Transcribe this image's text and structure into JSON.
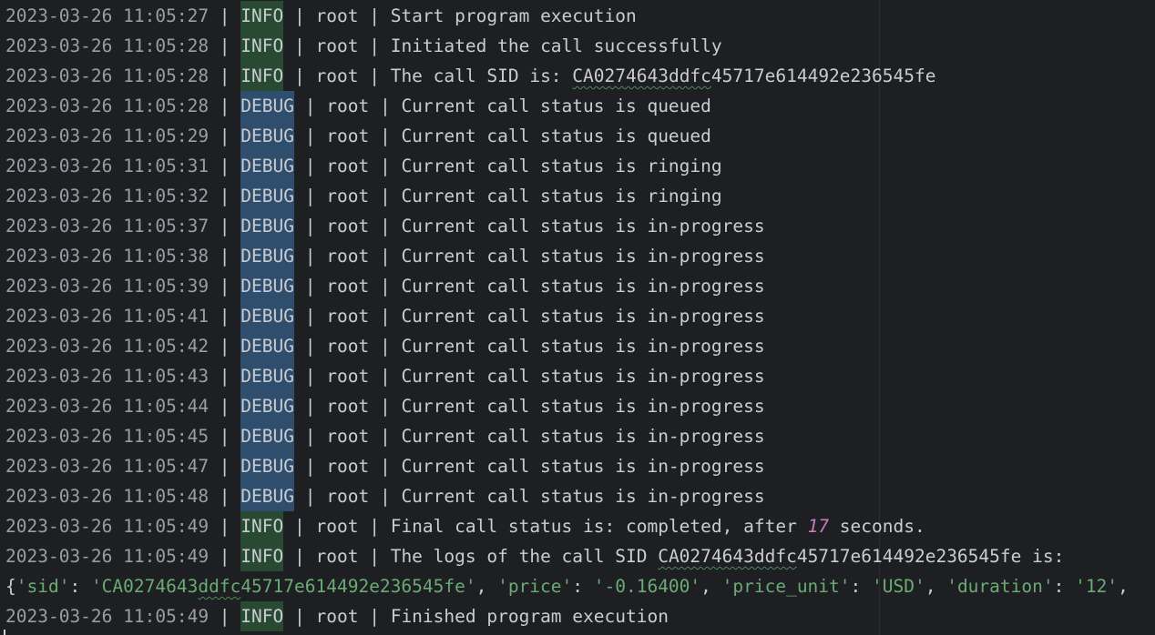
{
  "log_lines": [
    {
      "ts": "2023-03-26 11:05:27",
      "level": "INFO",
      "logger": "root",
      "msg": "Start program execution"
    },
    {
      "ts": "2023-03-26 11:05:28",
      "level": "INFO",
      "logger": "root",
      "msg": "Initiated the call successfully"
    },
    {
      "ts": "2023-03-26 11:05:28",
      "level": "INFO",
      "logger": "root",
      "msg_prefix": "The call SID is: ",
      "msg_mark": "CA0274643ddfc",
      "msg_suffix": "45717e614492e236545fe"
    },
    {
      "ts": "2023-03-26 11:05:28",
      "level": "DEBUG",
      "logger": "root",
      "msg": "Current call status is queued"
    },
    {
      "ts": "2023-03-26 11:05:29",
      "level": "DEBUG",
      "logger": "root",
      "msg": "Current call status is queued"
    },
    {
      "ts": "2023-03-26 11:05:31",
      "level": "DEBUG",
      "logger": "root",
      "msg": "Current call status is ringing"
    },
    {
      "ts": "2023-03-26 11:05:32",
      "level": "DEBUG",
      "logger": "root",
      "msg": "Current call status is ringing"
    },
    {
      "ts": "2023-03-26 11:05:37",
      "level": "DEBUG",
      "logger": "root",
      "msg": "Current call status is in-progress"
    },
    {
      "ts": "2023-03-26 11:05:38",
      "level": "DEBUG",
      "logger": "root",
      "msg": "Current call status is in-progress"
    },
    {
      "ts": "2023-03-26 11:05:39",
      "level": "DEBUG",
      "logger": "root",
      "msg": "Current call status is in-progress"
    },
    {
      "ts": "2023-03-26 11:05:41",
      "level": "DEBUG",
      "logger": "root",
      "msg": "Current call status is in-progress"
    },
    {
      "ts": "2023-03-26 11:05:42",
      "level": "DEBUG",
      "logger": "root",
      "msg": "Current call status is in-progress"
    },
    {
      "ts": "2023-03-26 11:05:43",
      "level": "DEBUG",
      "logger": "root",
      "msg": "Current call status is in-progress"
    },
    {
      "ts": "2023-03-26 11:05:44",
      "level": "DEBUG",
      "logger": "root",
      "msg": "Current call status is in-progress"
    },
    {
      "ts": "2023-03-26 11:05:45",
      "level": "DEBUG",
      "logger": "root",
      "msg": "Current call status is in-progress"
    },
    {
      "ts": "2023-03-26 11:05:47",
      "level": "DEBUG",
      "logger": "root",
      "msg": "Current call status is in-progress"
    },
    {
      "ts": "2023-03-26 11:05:48",
      "level": "DEBUG",
      "logger": "root",
      "msg": "Current call status is in-progress"
    },
    {
      "ts": "2023-03-26 11:05:49",
      "level": "INFO",
      "logger": "root",
      "msg_prefix": "Final call status is: completed, after ",
      "msg_num": "17",
      "msg_suffix": " seconds."
    },
    {
      "ts": "2023-03-26 11:05:49",
      "level": "INFO",
      "logger": "root",
      "msg_prefix": "The logs of the call SID ",
      "msg_mark": "CA0274643ddfc",
      "msg_suffix": "45717e614492e236545fe is:"
    },
    {
      "dict_line": true,
      "parts": [
        "{",
        "'sid'",
        ": ",
        "'CA0274643",
        "ddfc",
        "45717e614492e236545fe'",
        ", ",
        "'price'",
        ": ",
        "'-0.16400'",
        ", ",
        "'price_unit'",
        ": ",
        "'USD'",
        ", ",
        "'duration'",
        ": ",
        "'12'",
        ","
      ]
    },
    {
      "ts": "2023-03-26 11:05:49",
      "level": "INFO",
      "logger": "root",
      "msg": "Finished program execution"
    }
  ],
  "separator": " | ",
  "colors": {
    "background": "#1e1f22",
    "info_bg": "#294a32",
    "debug_bg": "#2f4d6c",
    "string": "#6aab73",
    "number": "#c77dbb",
    "timestamp": "#9a9da3"
  }
}
